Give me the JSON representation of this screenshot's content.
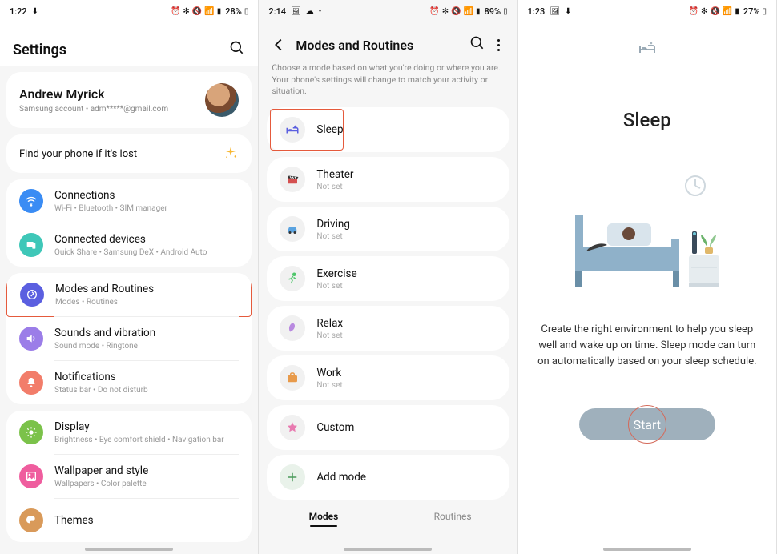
{
  "screen1": {
    "status": {
      "time": "1:22",
      "battery": "28%"
    },
    "title": "Settings",
    "profile": {
      "name": "Andrew Myrick",
      "sub": "Samsung account  •  adm*****@gmail.com"
    },
    "find": "Find your phone if it's lost",
    "groups": [
      [
        {
          "label": "Connections",
          "sub": "Wi-Fi  •  Bluetooth  •  SIM manager"
        },
        {
          "label": "Connected devices",
          "sub": "Quick Share  •  Samsung DeX  •  Android Auto"
        }
      ],
      [
        {
          "label": "Modes and Routines",
          "sub": "Modes  •  Routines"
        },
        {
          "label": "Sounds and vibration",
          "sub": "Sound mode  •  Ringtone"
        },
        {
          "label": "Notifications",
          "sub": "Status bar  •  Do not disturb"
        }
      ],
      [
        {
          "label": "Display",
          "sub": "Brightness  •  Eye comfort shield  •  Navigation bar"
        },
        {
          "label": "Wallpaper and style",
          "sub": "Wallpapers  •  Color palette"
        },
        {
          "label": "Themes",
          "sub": ""
        }
      ]
    ]
  },
  "screen2": {
    "status": {
      "time": "2:14",
      "battery": "89%"
    },
    "title": "Modes and Routines",
    "desc": "Choose a mode based on what you're doing or where you are. Your phone's settings will change to match your activity or situation.",
    "modes": [
      {
        "label": "Sleep",
        "sub": ""
      },
      {
        "label": "Theater",
        "sub": "Not set"
      },
      {
        "label": "Driving",
        "sub": "Not set"
      },
      {
        "label": "Exercise",
        "sub": "Not set"
      },
      {
        "label": "Relax",
        "sub": "Not set"
      },
      {
        "label": "Work",
        "sub": "Not set"
      },
      {
        "label": "Custom",
        "sub": ""
      },
      {
        "label": "Add mode",
        "sub": ""
      }
    ],
    "tabs": {
      "modes": "Modes",
      "routines": "Routines"
    }
  },
  "screen3": {
    "status": {
      "time": "1:23",
      "battery": "27%"
    },
    "title": "Sleep",
    "desc": "Create the right environment to help you sleep well and wake up on time. Sleep mode can turn on automatically based on your sleep schedule.",
    "button": "Start"
  }
}
